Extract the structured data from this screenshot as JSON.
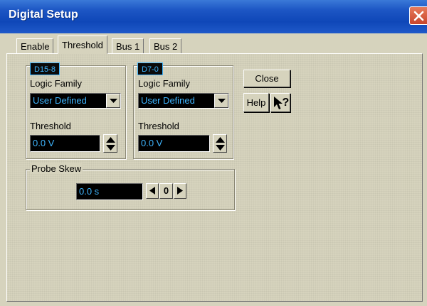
{
  "window": {
    "title": "Digital Setup",
    "close_icon": "close-icon"
  },
  "tabs": [
    {
      "label": "Enable",
      "active": false
    },
    {
      "label": "Threshold",
      "active": true
    },
    {
      "label": "Bus 1",
      "active": false
    },
    {
      "label": "Bus 2",
      "active": false
    }
  ],
  "groups": {
    "high": {
      "header": "D15-8",
      "logic_family_label": "Logic Family",
      "logic_family_value": "User Defined",
      "threshold_label": "Threshold",
      "threshold_value": "0.0 V"
    },
    "low": {
      "header": "D7-0",
      "logic_family_label": "Logic Family",
      "logic_family_value": "User Defined",
      "threshold_label": "Threshold",
      "threshold_value": "0.0 V"
    }
  },
  "probe_skew": {
    "label": "Probe Skew",
    "value": "0.0 s",
    "step_value": "0"
  },
  "buttons": {
    "close": "Close",
    "help": "Help",
    "whats_this_icon": "whats-this-icon"
  },
  "colors": {
    "titlebar": "#1d56c4",
    "dialog_bg": "#d6d3bd",
    "field_bg": "#000000",
    "field_text": "#3fb6ff"
  }
}
